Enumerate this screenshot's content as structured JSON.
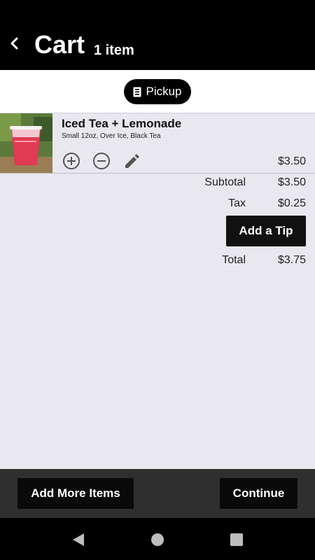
{
  "header": {
    "title": "Cart",
    "item_count": "1 item"
  },
  "order_mode": {
    "label": "Pickup",
    "icon": "receipt-icon"
  },
  "cart": {
    "items": [
      {
        "name": "Iced Tea + Lemonade",
        "options": "Small 12oz, Over Ice, Black Tea",
        "price": "$3.50"
      }
    ]
  },
  "summary": {
    "subtotal_label": "Subtotal",
    "subtotal": "$3.50",
    "tax_label": "Tax",
    "tax": "$0.25",
    "tip_button": "Add a Tip",
    "total_label": "Total",
    "total": "$3.75"
  },
  "footer": {
    "add_more_label": "Add More Items",
    "continue_label": "Continue"
  },
  "colors": {
    "header_bg": "#000000",
    "page_bg": "#e8e8ee",
    "button_bg": "#111111",
    "footer_bg": "#2f2f2f"
  }
}
